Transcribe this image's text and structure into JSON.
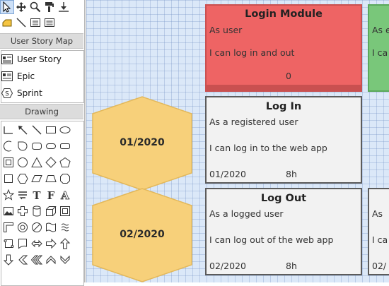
{
  "sidebar": {
    "sections": {
      "user_story_map": "User Story Map",
      "drawing": "Drawing"
    },
    "library_items": [
      {
        "label": "User Story",
        "icon": "user-story-icon"
      },
      {
        "label": "Epic",
        "icon": "epic-icon"
      },
      {
        "label": "Sprint",
        "icon": "sprint-icon"
      }
    ],
    "top_tools": [
      "pointer-icon",
      "pan-icon",
      "zoom-icon",
      "format-painter-icon",
      "align-icon",
      "fill-icon",
      "line-tool-icon",
      "text-box-icon",
      "list-icon"
    ],
    "drawing_tools": [
      "connector-icon",
      "arrow-icon",
      "line-icon",
      "rectangle-icon",
      "ellipse-icon",
      "arc-icon",
      "teardrop-icon",
      "rounded-rect-icon",
      "stadium-icon",
      "pill-icon",
      "frame-icon",
      "circle-icon",
      "triangle-icon",
      "diamond-icon",
      "pentagon-icon",
      "square-icon",
      "hexagon-shape-icon",
      "parallelogram-icon",
      "trapezoid-icon",
      "octagon-icon",
      "star-icon",
      "callout-icon",
      "text-icon",
      "text-art-icon",
      "text-style-icon",
      "picture-icon",
      "cross-icon",
      "can-icon",
      "cube-icon",
      "bevel-icon",
      "corner-icon",
      "donut-icon",
      "no-symbol-icon",
      "wave-icon",
      "double-wave-icon",
      "scroll-icon",
      "document-icon",
      "left-right-arrow-icon",
      "right-arrow-icon",
      "up-arrow-icon",
      "down-arrow-icon",
      "chevron-left-icon",
      "chevron-double-icon",
      "chevron-up-icon",
      "chevron-down-icon"
    ]
  },
  "canvas": {
    "epics": [
      {
        "title": "Login Module",
        "line1": "As user",
        "line2": "I can log in and out",
        "count": "0",
        "color": "#ee6464"
      },
      {
        "line1": "As e",
        "line2": "I ca",
        "color": "#79c77a"
      }
    ],
    "stories": [
      {
        "title": "Log In",
        "line1": "As a registered user",
        "line2": "I can log in to the web app",
        "date": "01/2020",
        "estimate": "8h"
      },
      {
        "title": "Log Out",
        "line1": "As a logged user",
        "line2": "I can log out of the web app",
        "date": "02/2020",
        "estimate": "8h"
      }
    ],
    "partial_story_lines": [
      "As",
      "I ca",
      "02/"
    ],
    "sprints": [
      {
        "label": "01/2020",
        "color": "#f7d07a"
      },
      {
        "label": "02/2020",
        "color": "#f7d07a"
      }
    ]
  }
}
